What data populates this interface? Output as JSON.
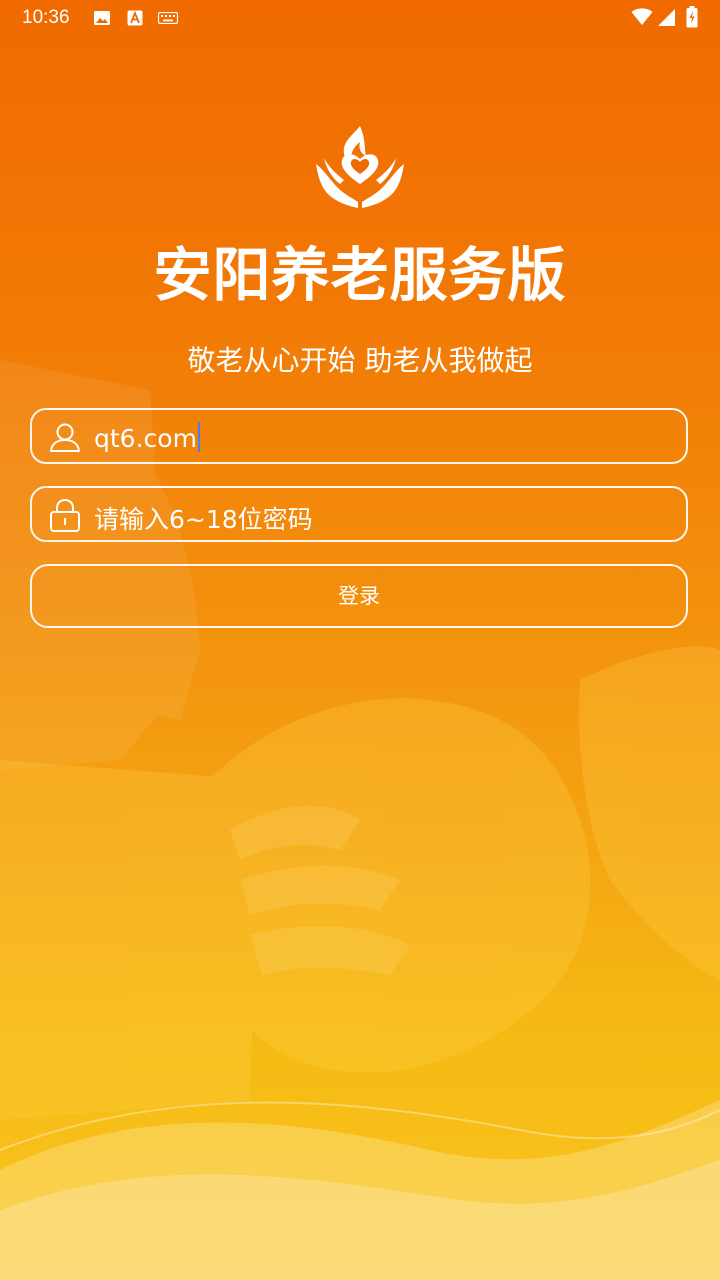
{
  "status_bar": {
    "time": "10:36",
    "icons": [
      "image-icon",
      "a-badge-icon",
      "keyboard-icon",
      "wifi-icon",
      "signal-icon",
      "battery-charging-icon"
    ]
  },
  "app": {
    "logo_icon": "heart-hands-logo-icon",
    "title": "安阳养老服务版",
    "slogan": "敬老从心开始 助老从我做起"
  },
  "login_form": {
    "username": {
      "value": "qt6.com",
      "icon": "user-icon"
    },
    "password": {
      "placeholder": "请输入6~18位密码",
      "icon": "lock-icon"
    },
    "login_label": "登录"
  },
  "colors": {
    "gradient_top": "#f06a00",
    "gradient_bottom": "#f8c520",
    "foreground": "#ffffff",
    "caret": "#4a7ff0"
  }
}
